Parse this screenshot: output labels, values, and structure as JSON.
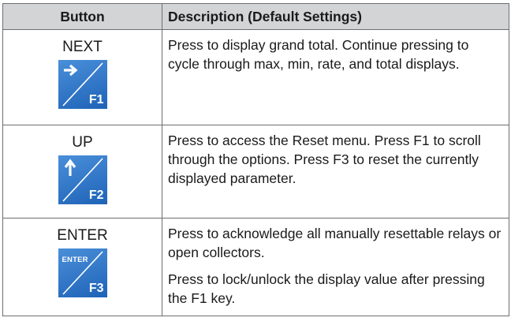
{
  "header": {
    "col_button": "Button",
    "col_description": "Description (Default Settings)"
  },
  "rows": [
    {
      "name": "NEXT",
      "key_label": "F1",
      "key_icon": "right-arrow-icon",
      "description": [
        "Press to display grand total. Continue pressing to cycle through max, min, rate, and total displays."
      ]
    },
    {
      "name": "UP",
      "key_label": "F2",
      "key_icon": "up-arrow-icon",
      "description": [
        "Press to access the Reset menu. Press F1 to scroll through the options. Press F3 to reset the currently displayed parameter."
      ]
    },
    {
      "name": "ENTER",
      "key_label": "F3",
      "key_text": "ENTER",
      "description": [
        "Press to acknowledge all manually resettable relays or open collectors.",
        "Press to lock/unlock the display value after pressing the F1 key."
      ]
    }
  ],
  "colors": {
    "key_blue": "#2f75c9",
    "header_bg": "#d3d4d6",
    "border": "#6d6e71"
  }
}
